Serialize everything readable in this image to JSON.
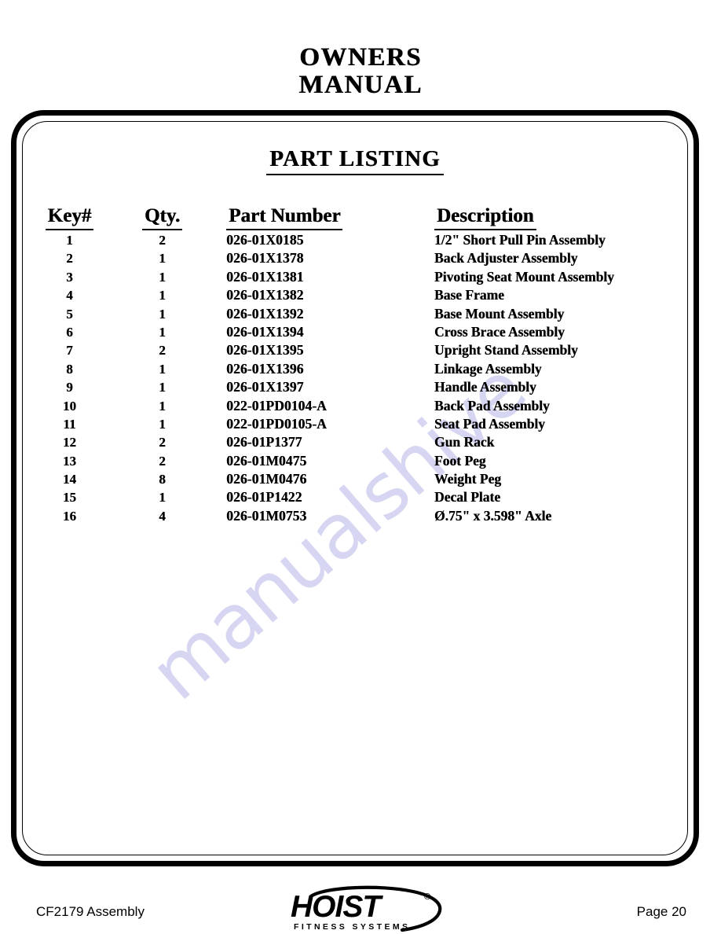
{
  "header": {
    "line1": "OWNERS",
    "line2": "MANUAL"
  },
  "section": {
    "title": "PART LISTING"
  },
  "watermark": {
    "text": "manualshive",
    "color": "#c9c9ee"
  },
  "table": {
    "columns": [
      {
        "key": "key",
        "label": "Key#"
      },
      {
        "key": "qty",
        "label": "Qty."
      },
      {
        "key": "part",
        "label": "Part Number"
      },
      {
        "key": "desc",
        "label": "Description"
      }
    ],
    "rows": [
      {
        "key": "1",
        "qty": "2",
        "part": "026-01X0185",
        "desc": "1/2\" Short Pull Pin Assembly"
      },
      {
        "key": "2",
        "qty": "1",
        "part": "026-01X1378",
        "desc": "Back Adjuster Assembly"
      },
      {
        "key": "3",
        "qty": "1",
        "part": "026-01X1381",
        "desc": "Pivoting Seat Mount Assembly"
      },
      {
        "key": "4",
        "qty": "1",
        "part": "026-01X1382",
        "desc": "Base Frame"
      },
      {
        "key": "5",
        "qty": "1",
        "part": "026-01X1392",
        "desc": "Base Mount Assembly"
      },
      {
        "key": "6",
        "qty": "1",
        "part": "026-01X1394",
        "desc": "Cross Brace Assembly"
      },
      {
        "key": "7",
        "qty": "2",
        "part": "026-01X1395",
        "desc": "Upright Stand Assembly"
      },
      {
        "key": "8",
        "qty": "1",
        "part": "026-01X1396",
        "desc": "Linkage Assembly"
      },
      {
        "key": "9",
        "qty": "1",
        "part": "026-01X1397",
        "desc": "Handle Assembly"
      },
      {
        "key": "10",
        "qty": "1",
        "part": "022-01PD0104-A",
        "desc": "Back Pad Assembly"
      },
      {
        "key": "11",
        "qty": "1",
        "part": "022-01PD0105-A",
        "desc": "Seat Pad Assembly"
      },
      {
        "key": "12",
        "qty": "2",
        "part": "026-01P1377",
        "desc": "Gun Rack"
      },
      {
        "key": "13",
        "qty": "2",
        "part": "026-01M0475",
        "desc": "Foot Peg"
      },
      {
        "key": "14",
        "qty": "8",
        "part": "026-01M0476",
        "desc": "Weight Peg"
      },
      {
        "key": "15",
        "qty": "1",
        "part": "026-01P1422",
        "desc": "Decal Plate"
      },
      {
        "key": "16",
        "qty": "4",
        "part": "026-01M0753",
        "desc": "Ø.75\" x 3.598\" Axle"
      }
    ]
  },
  "footer": {
    "left": "CF2179 Assembly",
    "right": "Page 20",
    "logo": {
      "name": "HOIST",
      "registered": "®",
      "tagline": "FITNESS SYSTEMS"
    }
  }
}
